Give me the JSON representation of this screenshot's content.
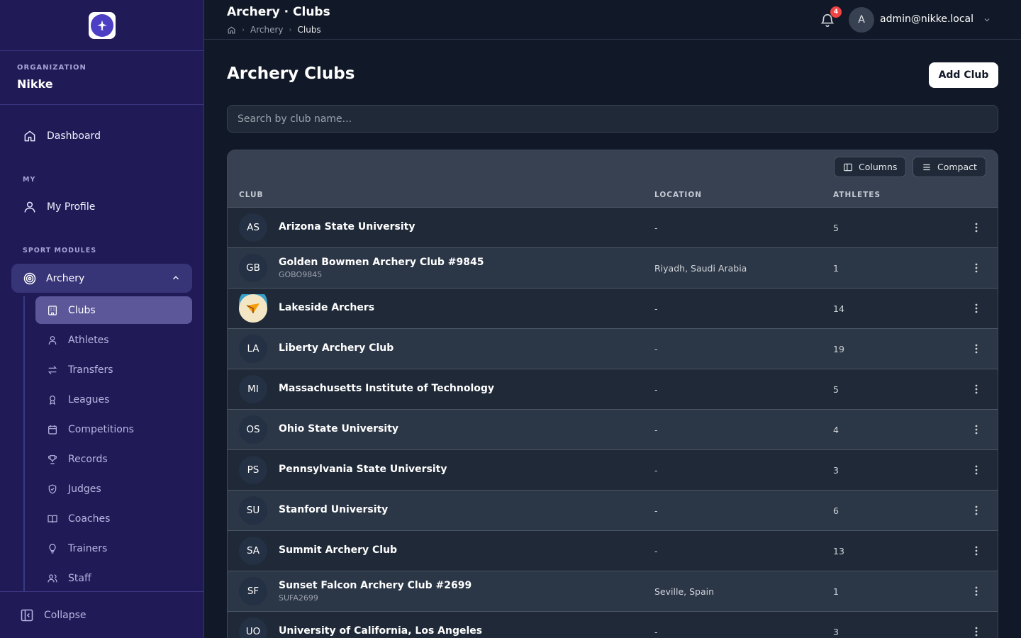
{
  "header": {
    "title": "Archery · Clubs",
    "breadcrumbs": [
      "Archery",
      "Clubs"
    ],
    "notifications": "4",
    "avatar_initial": "A",
    "user_email": "admin@nikke.local"
  },
  "sidebar": {
    "org_label": "ORGANIZATION",
    "org_name": "Nikke",
    "dashboard": "Dashboard",
    "my_label": "MY",
    "my_profile": "My Profile",
    "modules_label": "SPORT MODULES",
    "module": "Archery",
    "sub_items": [
      {
        "label": "Clubs",
        "icon": "building-icon"
      },
      {
        "label": "Athletes",
        "icon": "user-icon"
      },
      {
        "label": "Transfers",
        "icon": "arrows-icon"
      },
      {
        "label": "Leagues",
        "icon": "award-icon"
      },
      {
        "label": "Competitions",
        "icon": "calendar-icon"
      },
      {
        "label": "Records",
        "icon": "trophy-icon"
      },
      {
        "label": "Judges",
        "icon": "shield-icon"
      },
      {
        "label": "Coaches",
        "icon": "book-icon"
      },
      {
        "label": "Trainers",
        "icon": "lightbulb-icon"
      },
      {
        "label": "Staff",
        "icon": "users-icon"
      }
    ],
    "collapse": "Collapse"
  },
  "main": {
    "page_title": "Archery Clubs",
    "add_button": "Add Club",
    "search_placeholder": "Search by club name...",
    "columns_button": "Columns",
    "compact_button": "Compact",
    "table_headers": [
      "CLUB",
      "LOCATION",
      "ATHLETES"
    ],
    "rows": [
      {
        "initials": "AS",
        "name": "Arizona State University",
        "code": "",
        "location": "-",
        "athletes": "5"
      },
      {
        "initials": "GB",
        "name": "Golden Bowmen Archery Club #9845",
        "code": "GOBO9845",
        "location": "Riyadh, Saudi Arabia",
        "athletes": "1"
      },
      {
        "initials": "",
        "name": "Lakeside Archers",
        "code": "",
        "location": "-",
        "athletes": "14"
      },
      {
        "initials": "LA",
        "name": "Liberty Archery Club",
        "code": "",
        "location": "-",
        "athletes": "19"
      },
      {
        "initials": "MI",
        "name": "Massachusetts Institute of Technology",
        "code": "",
        "location": "-",
        "athletes": "5"
      },
      {
        "initials": "OS",
        "name": "Ohio State University",
        "code": "",
        "location": "-",
        "athletes": "4"
      },
      {
        "initials": "PS",
        "name": "Pennsylvania State University",
        "code": "",
        "location": "-",
        "athletes": "3"
      },
      {
        "initials": "SU",
        "name": "Stanford University",
        "code": "",
        "location": "-",
        "athletes": "6"
      },
      {
        "initials": "SA",
        "name": "Summit Archery Club",
        "code": "",
        "location": "-",
        "athletes": "13"
      },
      {
        "initials": "SF",
        "name": "Sunset Falcon Archery Club #2699",
        "code": "SUFA2699",
        "location": "Seville, Spain",
        "athletes": "1"
      },
      {
        "initials": "UO",
        "name": "University of California, Los Angeles",
        "code": "",
        "location": "-",
        "athletes": "3"
      }
    ]
  }
}
